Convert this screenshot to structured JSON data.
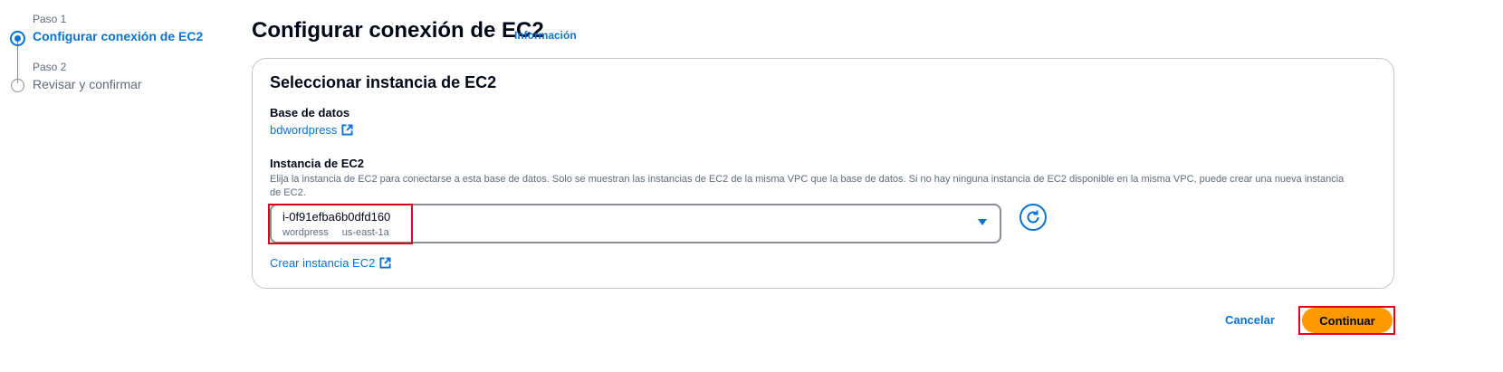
{
  "stepper": {
    "steps": [
      {
        "number": "Paso 1",
        "title": "Configurar conexión de EC2",
        "state": "active"
      },
      {
        "number": "Paso 2",
        "title": "Revisar y confirmar",
        "state": "inactive"
      }
    ]
  },
  "header": {
    "title": "Configurar conexión de EC2",
    "info_link": "Información"
  },
  "card": {
    "title": "Seleccionar instancia de EC2",
    "database": {
      "label": "Base de datos",
      "link": "bdwordpress",
      "link_icon": "external-link-icon"
    },
    "instance": {
      "label": "Instancia de EC2",
      "description": "Elija la instancia de EC2 para conectarse a esta base de datos. Solo se muestran las instancias de EC2 de la misma VPC que la base de datos. Si no hay ninguna instancia de EC2 disponible en la misma VPC, puede crear una nueva instancia de EC2.",
      "selected_value": "i-0f91efba6b0dfd160",
      "tags": [
        "wordpress",
        "us-east-1a"
      ],
      "refresh_icon": "refresh-icon"
    },
    "create_link": "Crear instancia EC2"
  },
  "footer": {
    "cancel_label": "Cancelar",
    "continue_label": "Continuar"
  },
  "colors": {
    "accent": "#0972d3",
    "primary_button": "#ff9900",
    "highlight": "#e0001b",
    "border": "#c6c6cd",
    "muted_text": "#5f6b7a"
  }
}
